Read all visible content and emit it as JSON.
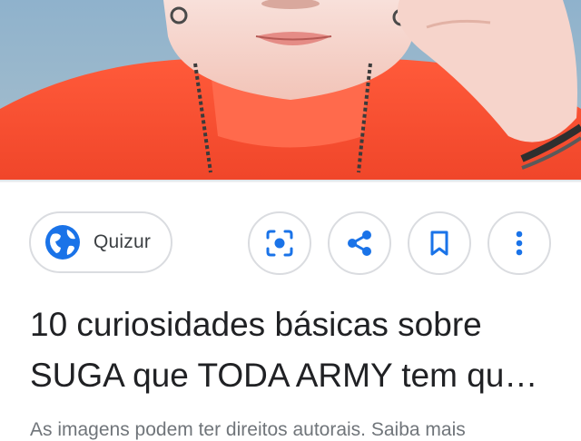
{
  "source_chip": {
    "label": "Quizur",
    "icon": "globe-icon"
  },
  "actions": [
    {
      "name": "lens-button",
      "icon": "lens-icon"
    },
    {
      "name": "share-button",
      "icon": "share-icon"
    },
    {
      "name": "bookmark-button",
      "icon": "bookmark-icon"
    },
    {
      "name": "more-options-button",
      "icon": "more-vert-icon"
    }
  ],
  "title": {
    "line1": "10 curiosidades básicas sobre",
    "line2": "SUGA que TODA ARMY tem qu…"
  },
  "disclaimer": "As imagens podem ter direitos autorais. Saiba mais",
  "colors": {
    "accent": "#1a73e8",
    "title": "#202124",
    "muted": "#70757a",
    "border": "#dadce0"
  }
}
